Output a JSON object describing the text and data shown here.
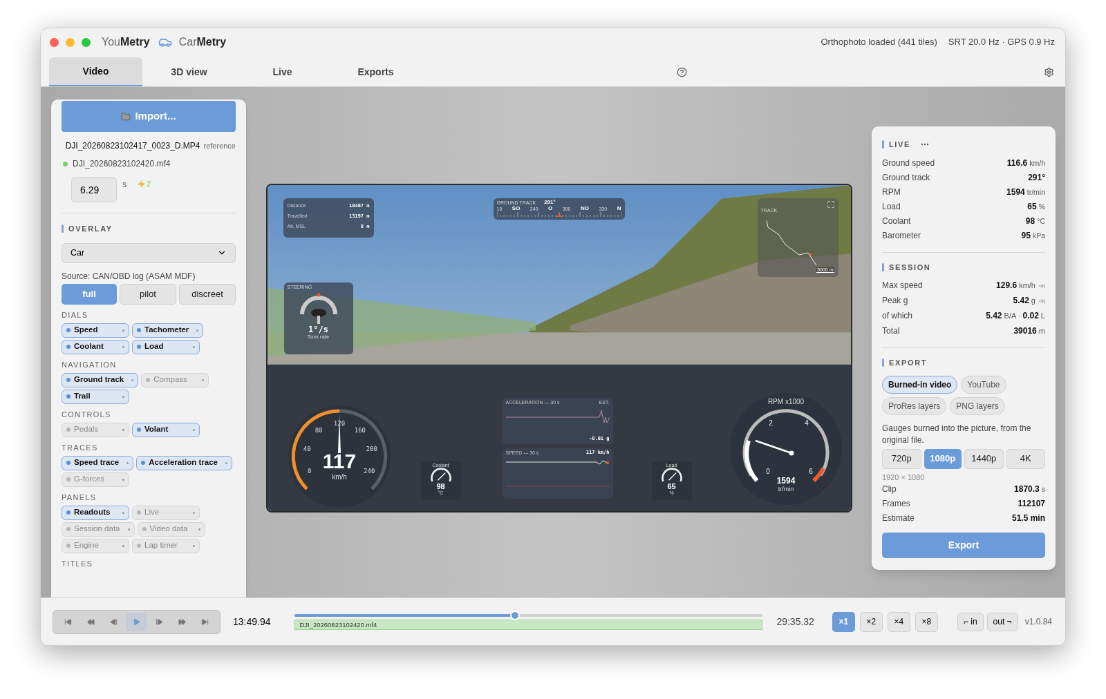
{
  "titlebar": {
    "brands": [
      {
        "text": "You**Metry**",
        "icon": false
      },
      {
        "text": "Car**Metry**",
        "icon": true
      }
    ],
    "status": [
      "Orthophoto loaded (441 tiles)",
      "SRT 20.0 Hz · GPS 0.9 Hz"
    ]
  },
  "tabs": [
    {
      "label": "Video",
      "selected": true
    },
    {
      "label": "3D view",
      "selected": false
    },
    {
      "label": "Live",
      "selected": false
    },
    {
      "label": "Exports",
      "selected": false
    }
  ],
  "left_panel": {
    "import_button": "Import...",
    "files": [
      {
        "kind": "video",
        "name": "DJI_20260823102417_0023_D.MP4",
        "tag": "reference"
      },
      {
        "kind": "log",
        "name": "DJI_20260823102420.mf4",
        "color": "#7ccf6e"
      }
    ],
    "offset": {
      "value": "6.29",
      "unit": "s",
      "sync_count": "2"
    },
    "overlay": {
      "title": "OVERLAY",
      "select": "Car",
      "source": "Source: CAN/OBD log (ASAM MDF)",
      "modes": [
        {
          "label": "full",
          "selected": true
        },
        {
          "label": "pilot",
          "selected": false
        },
        {
          "label": "discreet",
          "selected": false
        }
      ]
    },
    "groups": [
      {
        "title": "DIALS",
        "items": [
          {
            "label": "Speed",
            "on": true
          },
          {
            "label": "Tachometer",
            "on": true
          },
          {
            "label": "Coolant",
            "on": true
          },
          {
            "label": "Load",
            "on": true
          }
        ]
      },
      {
        "title": "NAVIGATION",
        "items": [
          {
            "label": "Ground track",
            "on": true
          },
          {
            "label": "Compass",
            "on": false
          },
          {
            "label": "Trail",
            "on": true
          }
        ]
      },
      {
        "title": "CONTROLS",
        "items": [
          {
            "label": "Pedals",
            "on": false
          },
          {
            "label": "Volant",
            "on": true
          }
        ]
      },
      {
        "title": "TRACES",
        "items": [
          {
            "label": "Speed trace",
            "on": true
          },
          {
            "label": "Acceleration trace",
            "on": true
          },
          {
            "label": "G-forces",
            "on": false
          }
        ]
      },
      {
        "title": "PANELS",
        "items": [
          {
            "label": "Readouts",
            "on": true
          },
          {
            "label": "Live",
            "on": false
          },
          {
            "label": "Session data",
            "on": false
          },
          {
            "label": "Video data",
            "on": false
          },
          {
            "label": "Engine",
            "on": false
          },
          {
            "label": "Lap timer",
            "on": false
          }
        ]
      },
      {
        "title": "TITLES"
      }
    ]
  },
  "video": {
    "readouts": [
      {
        "label": "Distance",
        "value": "10467 m"
      },
      {
        "label": "Travelled",
        "value": "13197 m"
      },
      {
        "label": "Alt. MSL",
        "value": "0 m"
      }
    ],
    "ground_track": {
      "title": "GROUND TRACK",
      "heading": "291°",
      "scale": [
        "10",
        "SO",
        "240",
        "O",
        "300",
        "NO",
        "330",
        "N"
      ]
    },
    "steering": {
      "title": "STEERING",
      "rate": "1°/s",
      "caption": "Turn rate"
    },
    "track": {
      "title": "TRACK",
      "scale": "5000 m"
    },
    "acceleration": {
      "title": "ACCELERATION — 30 s",
      "tag": "EST.",
      "value": "-0.01 g"
    },
    "speed_trace": {
      "title": "SPEED — 30 s",
      "value": "117 km/h"
    },
    "speed_gauge": {
      "ticks": [
        "0",
        "40",
        "80",
        "120",
        "160",
        "200",
        "240"
      ],
      "value": "117",
      "unit": "km/h"
    },
    "coolant_gauge": {
      "title": "Coolant",
      "value": "98",
      "unit": "°C"
    },
    "load_gauge": {
      "title": "Load",
      "value": "65",
      "unit": "%"
    },
    "rpm_gauge": {
      "title": "RPM x1000",
      "ticks": [
        "2",
        "4",
        "0",
        "6"
      ],
      "value": "1594",
      "unit": "tr/min"
    }
  },
  "right_panel": {
    "live": {
      "title": "LIVE",
      "rows": [
        {
          "label": "Ground speed",
          "value": "116.6",
          "unit": "km/h"
        },
        {
          "label": "Ground track",
          "value": "291°"
        },
        {
          "label": "RPM",
          "value": "1594",
          "unit": "tr/min"
        },
        {
          "label": "Load",
          "value": "65",
          "unit": "%"
        },
        {
          "label": "Coolant",
          "value": "98",
          "unit": "°C"
        },
        {
          "label": "Barometer",
          "value": "95",
          "unit": "kPa"
        }
      ]
    },
    "session": {
      "title": "SESSION",
      "rows": [
        {
          "label": "Max speed",
          "value": "**129.6** km/h",
          "jump": true
        },
        {
          "label": "Peak g",
          "value": "**5.42** g",
          "jump": true
        },
        {
          "label": "of which",
          "value": "**5.42** B/A · **0.02** L",
          "jump": false
        },
        {
          "label": "Total",
          "value": "**39016** m",
          "jump": false
        }
      ]
    },
    "export": {
      "title": "EXPORT",
      "options": [
        {
          "label": "Burned-in video",
          "selected": true
        },
        {
          "label": "YouTube",
          "selected": false
        },
        {
          "label": "ProRes layers",
          "selected": false
        },
        {
          "label": "PNG layers",
          "selected": false
        }
      ],
      "description": "Gauges burned into the picture, from the original file.",
      "resolutions": [
        {
          "label": "720p",
          "selected": false
        },
        {
          "label": "1080p",
          "selected": true
        },
        {
          "label": "1440p",
          "selected": false
        },
        {
          "label": "4K",
          "selected": false
        }
      ],
      "size": "1920 × 1080",
      "rows": [
        {
          "label": "Clip",
          "value": "1870.3",
          "unit": "s"
        },
        {
          "label": "Frames",
          "value": "112107"
        },
        {
          "label": "Estimate",
          "value": "51.5 min"
        }
      ],
      "button": "Export"
    }
  },
  "transport": {
    "buttons": [
      {
        "kind": "first",
        "selected": false
      },
      {
        "kind": "rewind",
        "selected": false
      },
      {
        "kind": "prev",
        "selected": false
      },
      {
        "kind": "play",
        "selected": true
      },
      {
        "kind": "next",
        "selected": false
      },
      {
        "kind": "forward",
        "selected": false
      },
      {
        "kind": "last",
        "selected": false
      }
    ],
    "current": "13:49.94",
    "level": 0.47,
    "clip": "DJI_20260823102420.mf4",
    "total": "29:35.32",
    "speeds": [
      {
        "label": "×1",
        "selected": true
      },
      {
        "label": "×2",
        "selected": false
      },
      {
        "label": "×4",
        "selected": false
      },
      {
        "label": "×8",
        "selected": false
      }
    ],
    "marks": [
      "⌐ in",
      "out ¬"
    ],
    "version": "v1.0.84"
  }
}
